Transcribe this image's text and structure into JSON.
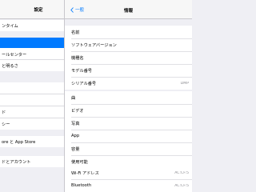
{
  "sidebar": {
    "title": "設定",
    "items": [
      {
        "label": "ンタイム"
      },
      {
        "label": ""
      },
      {
        "label": ""
      },
      {
        "label": "ールセンター"
      },
      {
        "label": ""
      },
      {
        "label": "と明るさ"
      },
      {
        "label": ""
      },
      {
        "label": ""
      },
      {
        "label": "ド"
      },
      {
        "label": ""
      },
      {
        "label": "シー"
      },
      {
        "label": "ore と App Store"
      },
      {
        "label": "ドとアカウント"
      }
    ]
  },
  "detail": {
    "back_label": "一般",
    "title": "情報",
    "group1": [
      {
        "label": "名前",
        "value": ""
      },
      {
        "label": "ソフトウェアバージョン",
        "value": ""
      },
      {
        "label": "機種名",
        "value": ""
      },
      {
        "label": "モデル番号",
        "value": ""
      },
      {
        "label": "シリアル番号",
        "value": "DMP"
      }
    ],
    "group2": [
      {
        "label": "曲",
        "value": ""
      },
      {
        "label": "ビデオ",
        "value": ""
      },
      {
        "label": "写真",
        "value": ""
      },
      {
        "label": "App",
        "value": ""
      },
      {
        "label": "容量",
        "value": ""
      },
      {
        "label": "使用可能",
        "value": ""
      }
    ],
    "group3": [
      {
        "label": "Wi-Fi アドレス",
        "value": "AC:CF:5"
      },
      {
        "label": "Bluetooth",
        "value": "AC:CF:5"
      }
    ]
  },
  "colors": {
    "accent": "#007aff",
    "background": "#efeff4",
    "separator": "#c8c7cc"
  },
  "icons": {
    "back": "chevron-left-icon"
  }
}
